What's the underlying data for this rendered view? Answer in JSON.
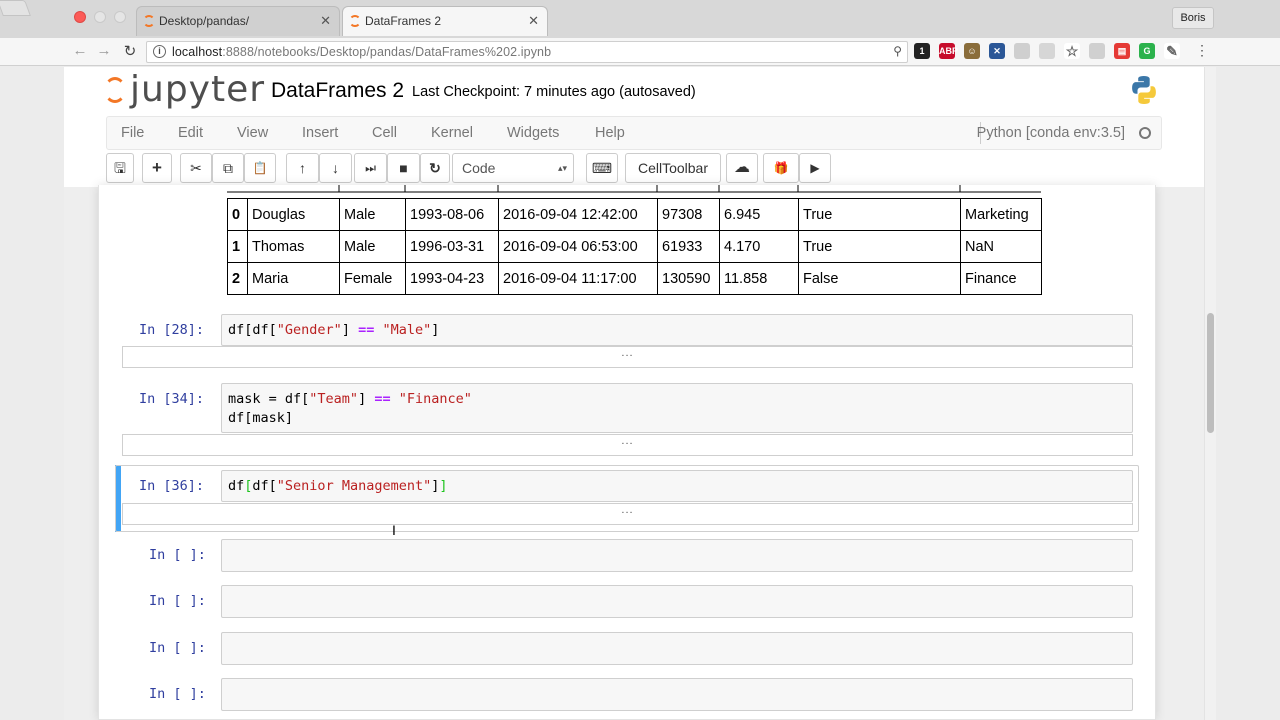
{
  "browser": {
    "tabs": [
      {
        "title": "Desktop/pandas/",
        "close": "✕"
      },
      {
        "title": "DataFrames 2",
        "close": "✕"
      }
    ],
    "profile": "Boris",
    "url": "localhost:8888/notebooks/Desktop/pandas/DataFrames%202.ipynb",
    "url_host": "localhost",
    "url_rest": ":8888/notebooks/Desktop/pandas/DataFrames%202.ipynb",
    "nav": {
      "back": "←",
      "forward": "→",
      "reload": "↻",
      "info": "i",
      "zoom": "⚲",
      "menu": "⋮"
    },
    "extensions": [
      {
        "label": "1",
        "color": "#222222",
        "name": "1password"
      },
      {
        "label": "ABP",
        "color": "#c70d2c",
        "name": "adblock"
      },
      {
        "label": "☺",
        "color": "#8a6d3b",
        "name": "avatar"
      },
      {
        "label": "✕",
        "color": "#2b5797",
        "name": "extension-x"
      },
      {
        "label": "",
        "color": "#cfcfcf",
        "name": "extension-grey-1"
      },
      {
        "label": "",
        "color": "#d6d6d6",
        "name": "extension-grey-2"
      },
      {
        "label": "☆",
        "color": "#ffffff",
        "name": "bookmark-star"
      },
      {
        "label": "",
        "color": "#d0d0d0",
        "name": "extension-grey-3"
      },
      {
        "label": "▤",
        "color": "#e53935",
        "name": "extension-red"
      },
      {
        "label": "G",
        "color": "#2bb24c",
        "name": "grammarly"
      },
      {
        "label": "✎",
        "color": "#ffffff",
        "name": "extension-pen"
      }
    ]
  },
  "jupyter": {
    "logo_text": "jupyter",
    "notebook_title": "DataFrames 2",
    "checkpoint": "Last Checkpoint: 7 minutes ago (autosaved)",
    "menu": [
      "File",
      "Edit",
      "View",
      "Insert",
      "Cell",
      "Kernel",
      "Widgets",
      "Help"
    ],
    "kernel": "Python [conda env:3.5]",
    "toolbar": {
      "save": "🖫",
      "add": "+",
      "cut": "✂",
      "copy": "⧉",
      "paste": "📋",
      "up": "↑",
      "down": "↓",
      "run": "⏭",
      "stop": "■",
      "restart": "↻",
      "cell_type": "Code",
      "cell_type_arrow": "▴▾",
      "keyboard": "⌨",
      "celltoolbar": "CellToolbar",
      "cloud": "☁",
      "gift": "🎁",
      "video": "▶"
    }
  },
  "dataframe": {
    "rows": [
      [
        "0",
        "Douglas",
        "Male",
        "1993-08-06",
        "2016-09-04 12:42:00",
        "97308",
        "6.945",
        "True",
        "Marketing"
      ],
      [
        "1",
        "Thomas",
        "Male",
        "1996-03-31",
        "2016-09-04 06:53:00",
        "61933",
        "4.170",
        "True",
        "NaN"
      ],
      [
        "2",
        "Maria",
        "Female",
        "1993-04-23",
        "2016-09-04 11:17:00",
        "130590",
        "11.858",
        "False",
        "Finance"
      ]
    ]
  },
  "cells": [
    {
      "prompt": "In [28]:",
      "code": [
        [
          {
            "t": "df[df["
          },
          {
            "t": "\"Gender\"",
            "c": "str"
          },
          {
            "t": "] "
          },
          {
            "t": "==",
            "c": "op"
          },
          {
            "t": " "
          },
          {
            "t": "\"Male\"",
            "c": "str"
          },
          {
            "t": "]"
          }
        ]
      ],
      "output": "..."
    },
    {
      "prompt": "In [34]:",
      "code": [
        [
          {
            "t": "mask = df["
          },
          {
            "t": "\"Team\"",
            "c": "str"
          },
          {
            "t": "] "
          },
          {
            "t": "==",
            "c": "op"
          },
          {
            "t": " "
          },
          {
            "t": "\"Finance\"",
            "c": "str"
          }
        ],
        [
          {
            "t": "df[mask]"
          }
        ]
      ],
      "output": "..."
    },
    {
      "prompt": "In [36]:",
      "code": [
        [
          {
            "t": "df"
          },
          {
            "t": "[",
            "c": "bracket-hl"
          },
          {
            "t": "df["
          },
          {
            "t": "\"Senior Management\"",
            "c": "str"
          },
          {
            "t": "]"
          },
          {
            "t": "]",
            "c": "bracket-hl"
          }
        ]
      ],
      "output": "..."
    },
    {
      "prompt": "In [ ]:",
      "code": [],
      "output": null
    },
    {
      "prompt": "In [ ]:",
      "code": [],
      "output": null
    },
    {
      "prompt": "In [ ]:",
      "code": [],
      "output": null
    },
    {
      "prompt": "In [ ]:",
      "code": [],
      "output": null
    }
  ]
}
